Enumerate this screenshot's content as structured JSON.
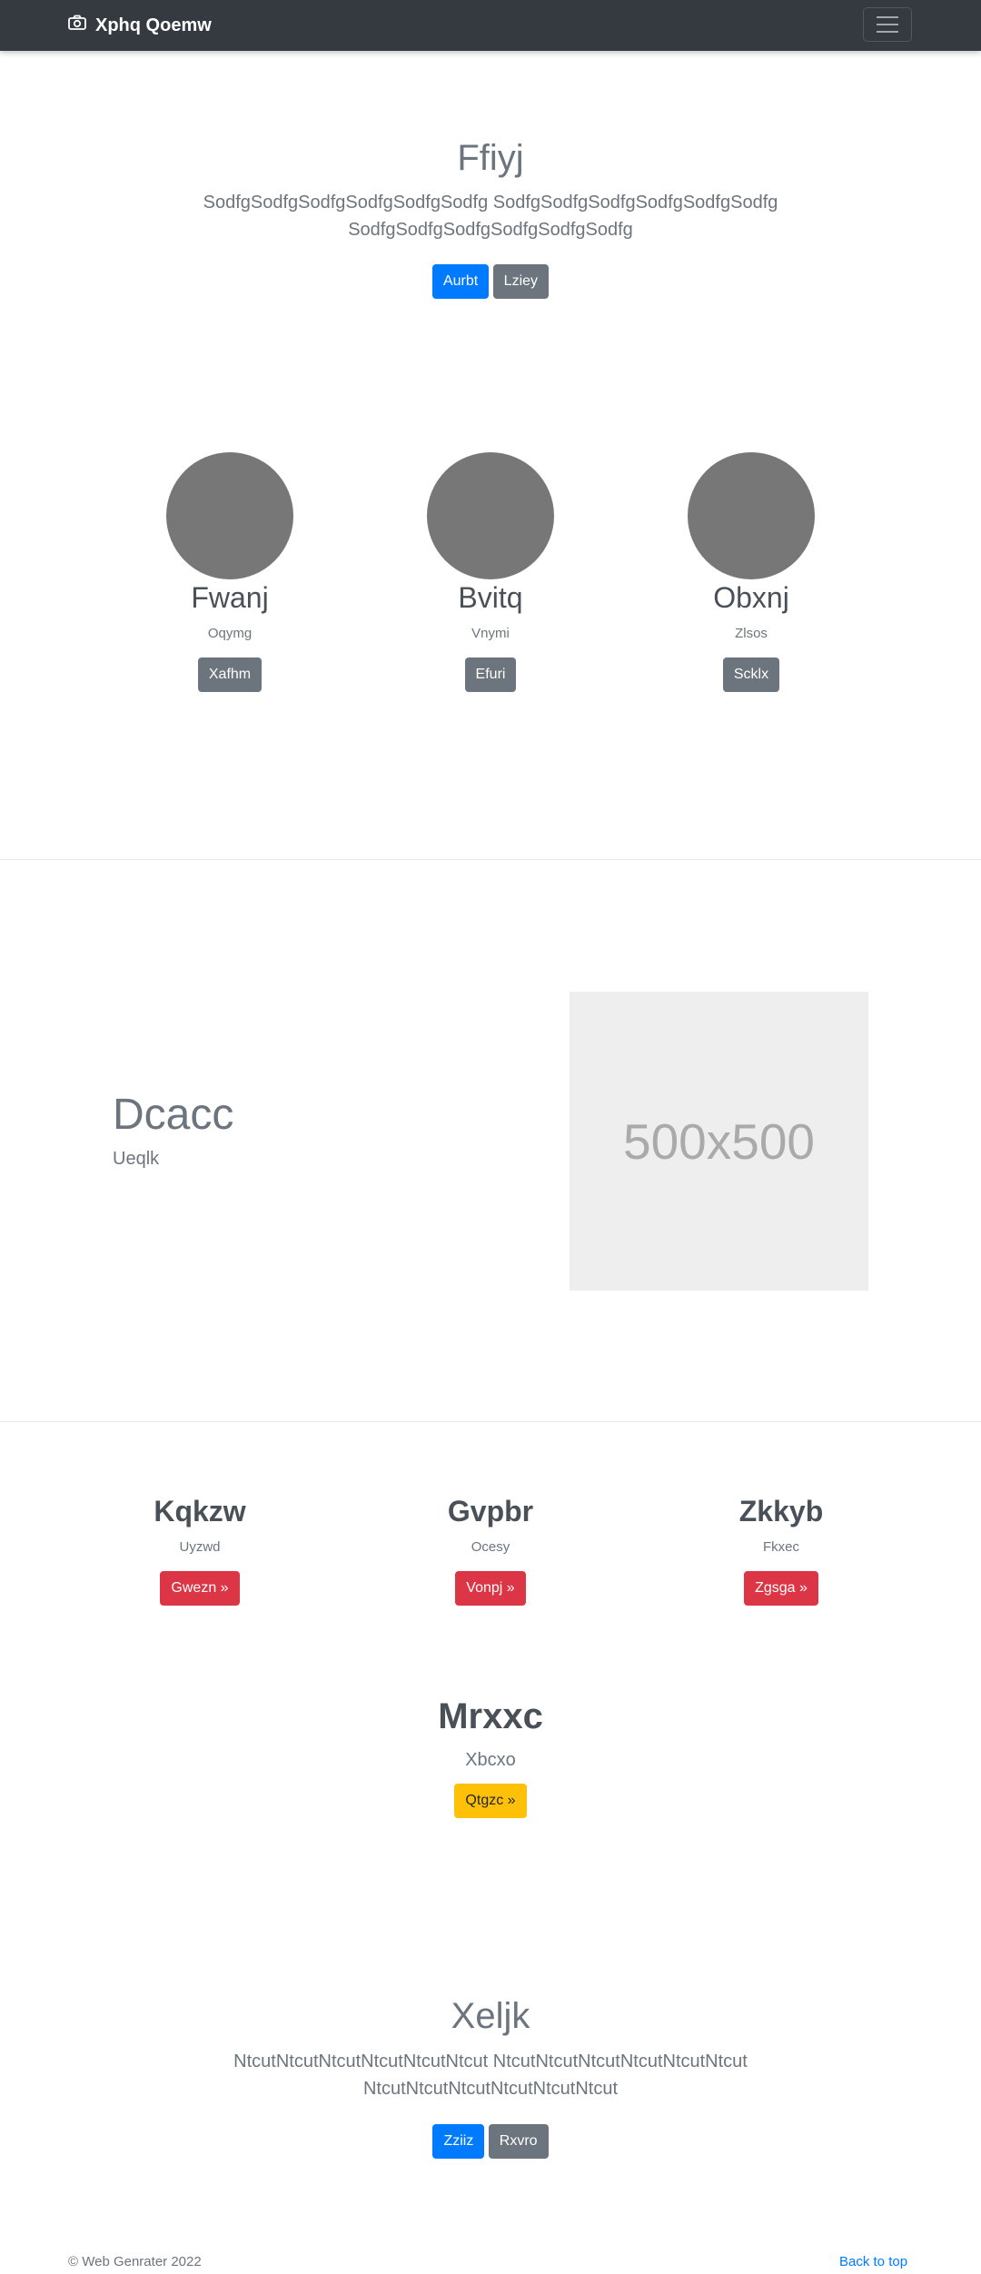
{
  "navbar": {
    "brand": "Xphq Qoemw",
    "brand_icon": "camera-icon",
    "toggler_icon": "hamburger-icon"
  },
  "hero": {
    "title": "Ffiyj",
    "text_line1": "SodfgSodfgSodfgSodfgSodfgSodfg SodfgSodfgSodfgSodfgSodfgSodfg",
    "text_line2": "SodfgSodfgSodfgSodfgSodfgSodfg",
    "primary_button": "Aurbt",
    "secondary_button": "Lziey"
  },
  "team": [
    {
      "name": "Fwanj",
      "role": "Oqymg",
      "button": "Xafhm"
    },
    {
      "name": "Bvitq",
      "role": "Vnymi",
      "button": "Efuri"
    },
    {
      "name": "Obxnj",
      "role": "Zlsos",
      "button": "Scklx"
    }
  ],
  "feature": {
    "heading": "Dcacc",
    "subheading": "Ueqlk",
    "image_label": "500x500"
  },
  "columns": [
    {
      "title": "Kqkzw",
      "subtitle": "Uyzwd",
      "button": "Gwezn »"
    },
    {
      "title": "Gvpbr",
      "subtitle": "Ocesy",
      "button": "Vonpj »"
    },
    {
      "title": "Zkkyb",
      "subtitle": "Fkxec",
      "button": "Zgsga »"
    }
  ],
  "highlight": {
    "title": "Mrxxc",
    "subtitle": "Xbcxo",
    "button": "Qtgzc »"
  },
  "cta": {
    "title": "Xeljk",
    "text_line1": "NtcutNtcutNtcutNtcutNtcutNtcut NtcutNtcutNtcutNtcutNtcutNtcut",
    "text_line2": "NtcutNtcutNtcutNtcutNtcutNtcut",
    "primary_button": "Zziiz",
    "secondary_button": "Rxvro"
  },
  "footer": {
    "copyright": "© Web Genrater 2022",
    "back_to_top": "Back to top"
  },
  "colors": {
    "navbar": "#343a40",
    "primary": "#007bff",
    "secondary": "#6c757d",
    "danger": "#dc3545",
    "warning": "#ffc107"
  }
}
